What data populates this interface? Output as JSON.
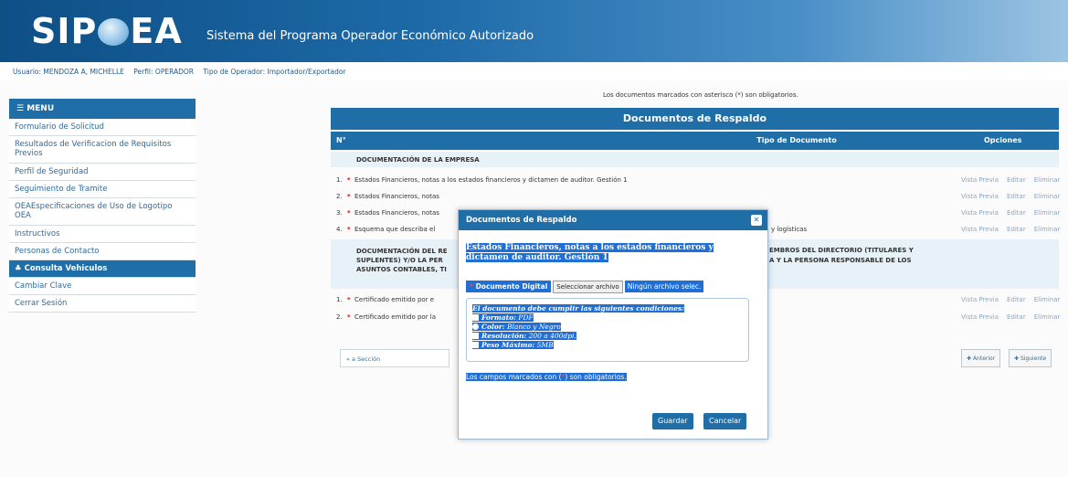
{
  "header": {
    "logo_left": "SIP",
    "logo_right": "EA",
    "system_title": "Sistema del Programa Operador Económico Autorizado"
  },
  "userbar": {
    "user": "Usuario: MENDOZA A, MICHELLE",
    "profile": "Perfil: OPERADOR",
    "operator_type": "Tipo de Operador: Importador/Exportador"
  },
  "sidebar": {
    "menu_label": "MENU",
    "items": [
      {
        "label": "Formulario de Solicitud"
      },
      {
        "label": "Resultados de Verificacion de Requisitos Previos"
      },
      {
        "label": "Perfil de Seguridad"
      },
      {
        "label": "Seguimiento de Tramite"
      },
      {
        "label": "OEAEspecificaciones de Uso de Logotipo OEA"
      },
      {
        "label": "Instructivos"
      },
      {
        "label": "Personas de Contacto"
      },
      {
        "label": "Consulta Vehiculos"
      },
      {
        "label": "Cambiar Clave"
      },
      {
        "label": "Cerrar Sesión"
      }
    ]
  },
  "main": {
    "notice": "Los documentos marcados con asterisco (*) son obligatorios.",
    "panel_title": "Documentos de Respaldo",
    "columns": {
      "num": "N°",
      "type": "Tipo de Documento",
      "options": "Opciones"
    },
    "section1": "DOCUMENTACIÓN DE LA EMPRESA",
    "rows1": [
      {
        "num": "1.",
        "text": "Estados Financieros, notas a los estados financieros y dictamen de auditor. Gestión 1"
      },
      {
        "num": "2.",
        "text": "Estados Financieros, notas"
      },
      {
        "num": "3.",
        "text": "Estados Financieros, notas"
      },
      {
        "num": "4.",
        "text": "Esquema que describa el",
        "tail": "y logísticas"
      }
    ],
    "section2_left": "DOCUMENTACIÓN DEL RE SUPLENTES) Y/O LA PER ASUNTOS CONTABLES, TI",
    "section2_right_l1": "EMBROS DEL DIRECTORIO (TITULARES Y",
    "section2_right_l2": "A Y LA PERSONA RESPONSABLE DE LOS",
    "rows2": [
      {
        "num": "1.",
        "text": "Certificado emitido por e"
      },
      {
        "num": "2.",
        "text": "Certificado emitido por la"
      }
    ],
    "options": {
      "preview": "Vista Previa",
      "edit": "Editar",
      "delete": "Eliminar"
    },
    "section_nav": "« a Sección",
    "prev_button": "Anterior",
    "next_button": "Siguiente"
  },
  "modal": {
    "title": "Documentos de Respaldo",
    "doc_heading": "Estados Financieros, notas a los estados financieros y dictamen de auditor. Gestión 1",
    "digital_label": "Documento Digital",
    "file_button": "Seleccionar archivo",
    "file_status": "Ningún archivo selec.",
    "conditions_title": "El documento debe cumplir las siguientes condiciones:",
    "conditions": [
      {
        "key": "Formato:",
        "value": "PDF"
      },
      {
        "key": "Color:",
        "value": "Blanco y Negro"
      },
      {
        "key": "Resolución:",
        "value": "200 a 400dpi."
      },
      {
        "key": "Peso Máximo:",
        "value": "5MB"
      }
    ],
    "required_note_pre": "Los campos marcados con (",
    "required_note_post": ") son obligatorios.",
    "save_button": "Guardar",
    "cancel_button": "Cancelar"
  },
  "colors": {
    "primary": "#1f6ea8",
    "highlight": "#1f6fd6",
    "required": "#e00000"
  }
}
